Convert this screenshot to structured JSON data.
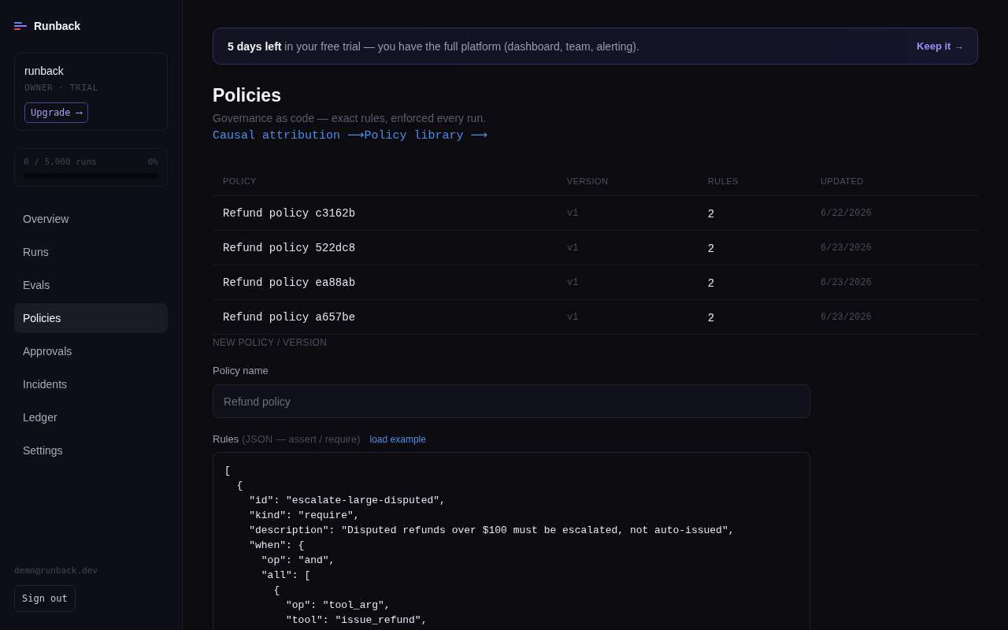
{
  "sidebar": {
    "brand": "Runback",
    "org": {
      "name": "runback",
      "role": "OWNER · TRIAL",
      "upgrade_button": "Upgrade ⟶"
    },
    "usage": {
      "label": "0 / 5,000 runs",
      "percent": "0%",
      "level": 0
    },
    "nav": [
      {
        "label": "Overview",
        "selected": false
      },
      {
        "label": "Runs",
        "selected": false
      },
      {
        "label": "Evals",
        "selected": false
      },
      {
        "label": "Policies",
        "selected": true
      },
      {
        "label": "Approvals",
        "selected": false
      },
      {
        "label": "Incidents",
        "selected": false
      },
      {
        "label": "Ledger",
        "selected": false
      },
      {
        "label": "Settings",
        "selected": false
      }
    ],
    "user_email": "demo@runback.dev",
    "sign_out_button": "Sign out"
  },
  "trial_banner": {
    "text": "**5 days left** in your free trial — you have the full platform (dashboard, team, alerting).",
    "action": "Keep it →"
  },
  "page": {
    "title": "Policies",
    "subtitle": "Governance as code — exact rules, enforced every run.",
    "links": [
      "Causal attribution ⟶",
      "Policy library ⟶"
    ]
  },
  "table": {
    "columns": [
      "POLICY",
      "VERSION",
      "RULES",
      "UPDATED"
    ],
    "rows": [
      {
        "policy": "Refund policy c3162b",
        "version": "v1",
        "rules": "2",
        "updated": "6/22/2026"
      },
      {
        "policy": "Refund policy 522dc8",
        "version": "v1",
        "rules": "2",
        "updated": "6/23/2026"
      },
      {
        "policy": "Refund policy ea88ab",
        "version": "v1",
        "rules": "2",
        "updated": "6/23/2026"
      },
      {
        "policy": "Refund policy a657be",
        "version": "v1",
        "rules": "2",
        "updated": "6/23/2026"
      }
    ]
  },
  "form": {
    "section_title": "NEW POLICY / VERSION",
    "name_label": "Policy name",
    "name_field": {
      "placeholder": "Refund policy"
    },
    "rules_label": "Rules",
    "rules_hint": "(JSON — assert / require)",
    "load_example_link": "load example",
    "rules_field": {
      "value": "[\n  {\n    \"id\": \"escalate-large-disputed\",\n    \"kind\": \"require\",\n    \"description\": \"Disputed refunds over $100 must be escalated, not auto-issued\",\n    \"when\": {\n      \"op\": \"and\",\n      \"all\": [\n        {\n          \"op\": \"tool_arg\",\n          \"tool\": \"issue_refund\","
    }
  }
}
